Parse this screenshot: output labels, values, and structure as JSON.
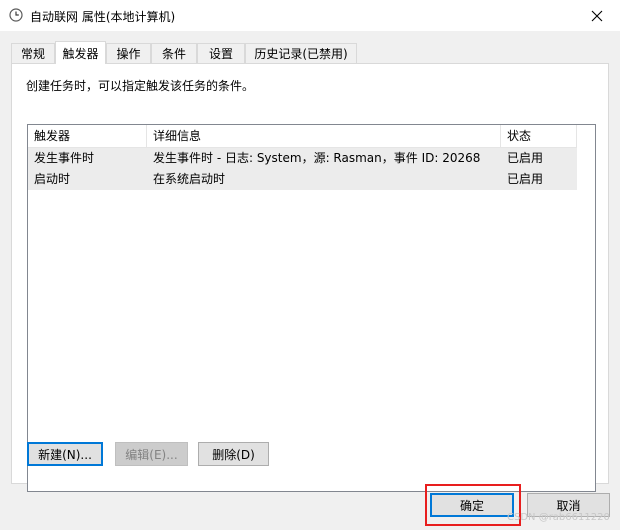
{
  "window": {
    "title": "自动联网 属性(本地计算机)",
    "icon": "task-scheduler-icon"
  },
  "tabs": [
    {
      "label": "常规",
      "active": false
    },
    {
      "label": "触发器",
      "active": true
    },
    {
      "label": "操作",
      "active": false
    },
    {
      "label": "条件",
      "active": false
    },
    {
      "label": "设置",
      "active": false
    },
    {
      "label": "历史记录(已禁用)",
      "active": false
    }
  ],
  "triggers": {
    "description": "创建任务时，可以指定触发该任务的条件。",
    "columns": [
      "触发器",
      "详细信息",
      "状态"
    ],
    "rows": [
      [
        "发生事件时",
        "发生事件时 - 日志: System，源: Rasman，事件 ID: 20268",
        "已启用"
      ],
      [
        "启动时",
        "在系统启动时",
        "已启用"
      ]
    ]
  },
  "buttons": {
    "new": "新建(N)...",
    "edit": "编辑(E)...",
    "delete": "删除(D)",
    "ok": "确定",
    "cancel": "取消"
  },
  "watermark": "CSDN @rab6611220",
  "colors": {
    "highlight": "#e81e1e",
    "default_button_border": "#0078d7"
  }
}
